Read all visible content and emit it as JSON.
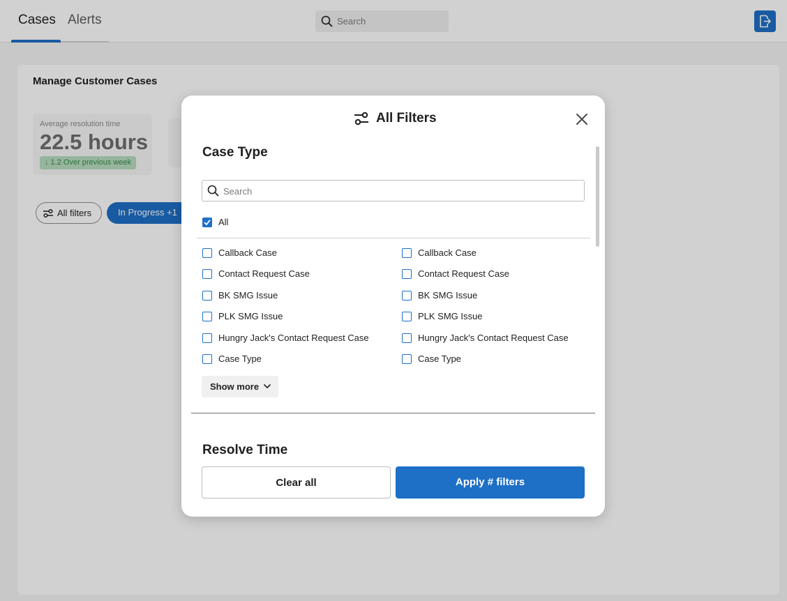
{
  "header": {
    "tabs": [
      {
        "label": "Cases",
        "active": true
      },
      {
        "label": "Alerts",
        "active": false
      }
    ],
    "search_placeholder": "Search",
    "logout_icon": "logout-icon"
  },
  "page": {
    "title": "Manage Customer Cases",
    "metric": {
      "label": "Average resolution time",
      "value": "22.5 hours",
      "delta": "↓ 1.2 Over previous week"
    },
    "chips": {
      "all_filters": "All filters",
      "status": "In Progress +1"
    }
  },
  "modal": {
    "title": "All Filters",
    "header_icon": "sliders-icon",
    "close_icon": "close-icon",
    "case_type": {
      "title": "Case Type",
      "search_placeholder": "Search",
      "all_label": "All",
      "all_checked": true,
      "options_left": [
        "Callback Case",
        "Contact Request Case",
        "BK SMG Issue",
        "PLK SMG Issue",
        "Hungry Jack's Contact Request Case",
        "Case Type"
      ],
      "options_right": [
        "Callback Case",
        "Contact Request Case",
        "BK SMG Issue",
        "PLK SMG Issue",
        "Hungry Jack's Contact Request Case",
        "Case Type"
      ],
      "show_more": "Show more"
    },
    "resolve_time": {
      "title": "Resolve Time"
    },
    "footer": {
      "clear_label": "Clear all",
      "apply_label": "Apply # filters"
    }
  },
  "colors": {
    "accent": "#1e6fc6",
    "positive_bg": "#b8ddbf",
    "positive_text": "#3b8a4e"
  }
}
